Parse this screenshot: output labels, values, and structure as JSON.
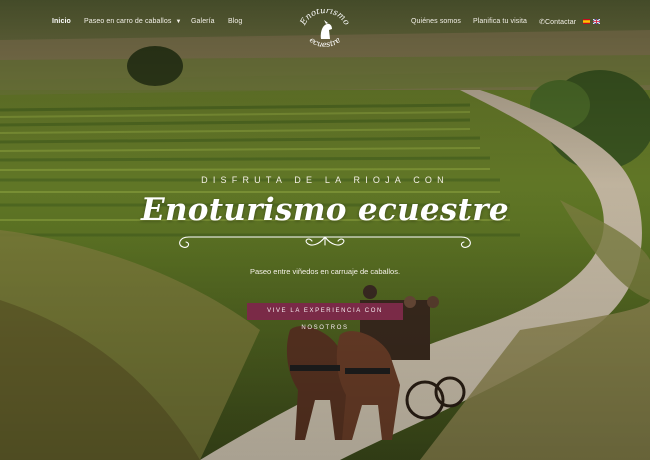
{
  "nav": {
    "left_items": [
      {
        "label": "Inicio",
        "active": true
      },
      {
        "label": "Paseo en carro de caballos",
        "has_dropdown": true
      },
      {
        "label": "Galería"
      },
      {
        "label": "Blog"
      }
    ],
    "right_items": [
      {
        "label": "Quiénes somos"
      },
      {
        "label": "Planifica tu visita"
      },
      {
        "label": "Contactar",
        "icon": "phone-icon"
      }
    ],
    "languages": [
      "es-flag-icon",
      "en-flag-icon"
    ]
  },
  "logo": {
    "line1": "Enoturismo",
    "line2": "ecuestre"
  },
  "hero": {
    "eyebrow": "DISFRUTA DE LA RIOJA CON",
    "title": "Enoturismo ecuestre",
    "subtitle": "Paseo entre viñedos en carruaje de caballos.",
    "cta": "VIVE LA EXPERIENCIA CON NOSOTROS"
  },
  "colors": {
    "accent": "#7a2a47",
    "text": "#ffffff"
  }
}
